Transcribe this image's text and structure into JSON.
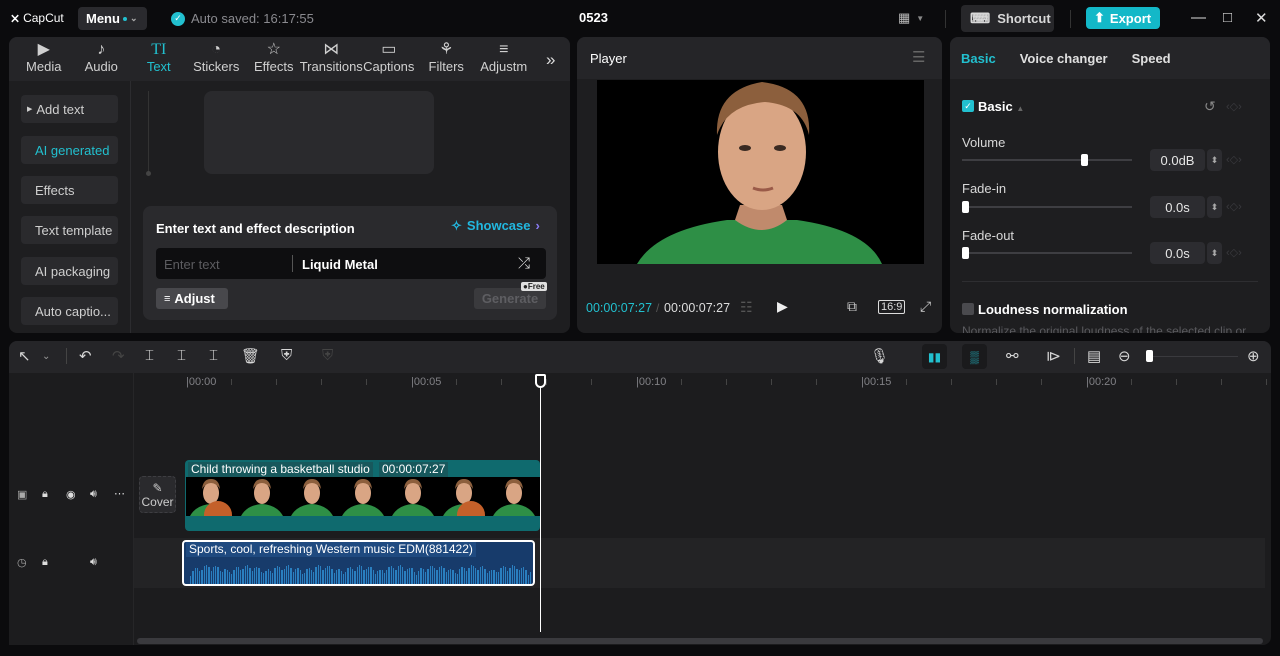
{
  "app": {
    "logo": "CapCut",
    "menu_label": "Menu",
    "autosave": "Auto saved: 16:17:55",
    "project_title": "0523",
    "shortcut_label": "Shortcut",
    "export_label": "Export",
    "accent_color": "#22c0cf"
  },
  "library": {
    "tabs": [
      {
        "label": "Media",
        "icon": "media-icon"
      },
      {
        "label": "Audio",
        "icon": "audio-icon"
      },
      {
        "label": "Text",
        "icon": "text-icon",
        "active": true
      },
      {
        "label": "Stickers",
        "icon": "stickers-icon"
      },
      {
        "label": "Effects",
        "icon": "effects-icon"
      },
      {
        "label": "Transitions",
        "icon": "transitions-icon"
      },
      {
        "label": "Captions",
        "icon": "captions-icon"
      },
      {
        "label": "Filters",
        "icon": "filters-icon"
      },
      {
        "label": "Adjustm",
        "icon": "adjustment-icon"
      }
    ],
    "sidebar": [
      {
        "label": "Add text"
      },
      {
        "label": "AI generated",
        "active": true
      },
      {
        "label": "Effects"
      },
      {
        "label": "Text template"
      },
      {
        "label": "AI packaging"
      },
      {
        "label": "Auto captio..."
      }
    ],
    "ai_panel": {
      "title": "Enter text and effect description",
      "showcase_label": "Showcase",
      "text_placeholder": "Enter text",
      "effect_value": "Liquid Metal",
      "adjust_label": "Adjust",
      "generate_label": "Generate",
      "free_badge": "Free"
    }
  },
  "player": {
    "title": "Player",
    "current_time": "00:00:07:27",
    "total_time": "00:00:07:27",
    "aspect_ratio": "16:9"
  },
  "properties": {
    "tabs": [
      {
        "label": "Basic",
        "active": true
      },
      {
        "label": "Voice changer"
      },
      {
        "label": "Speed"
      }
    ],
    "section_title": "Basic",
    "section_enabled": true,
    "volume": {
      "label": "Volume",
      "value": "0.0dB",
      "slider_fraction": 0.73
    },
    "fade_in": {
      "label": "Fade-in",
      "value": "0.0s",
      "slider_fraction": 0.0
    },
    "fade_out": {
      "label": "Fade-out",
      "value": "0.0s",
      "slider_fraction": 0.0
    },
    "loudness": {
      "label": "Loudness normalization",
      "enabled": false,
      "description": "Normalize the original loudness of the selected clip or"
    }
  },
  "timeline": {
    "ruler_labels": [
      "00:00",
      "00:05",
      "00:10",
      "00:15",
      "00:20"
    ],
    "video_clip": {
      "title": "Child throwing a basketball studio",
      "duration": "00:00:07:27"
    },
    "audio_clip": {
      "title": "Sports, cool, refreshing Western music EDM(881422)"
    },
    "cover_label": "Cover"
  }
}
